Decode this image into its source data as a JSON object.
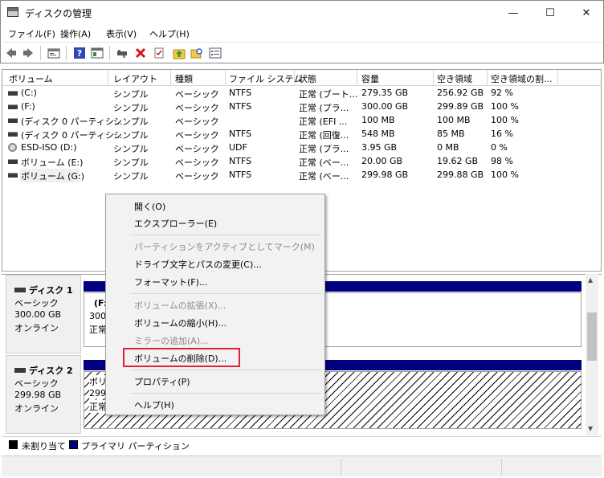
{
  "window": {
    "title": "ディスクの管理",
    "minimize_glyph": "—",
    "maximize_glyph": "☐",
    "close_glyph": "✕"
  },
  "menu": [
    "ファイル(F)",
    "操作(A)",
    "表示(V)",
    "ヘルプ(H)"
  ],
  "toolbar_icons": [
    "back-icon",
    "forward-icon",
    "properties-icon",
    "help-icon",
    "view-icon",
    "connect-icon",
    "delete-icon",
    "check-icon",
    "up-icon",
    "search-icon",
    "list-icon"
  ],
  "columns": [
    "ボリューム",
    "レイアウト",
    "種類",
    "ファイル システム",
    "状態",
    "容量",
    "空き領域",
    "空き領域の割..."
  ],
  "volumes": [
    {
      "name": "(C:)",
      "layout": "シンプル",
      "type": "ベーシック",
      "fs": "NTFS",
      "status": "正常 (ブート...",
      "capacity": "279.35 GB",
      "free": "256.92 GB",
      "pct": "92 %",
      "icon": "drive"
    },
    {
      "name": "(F:)",
      "layout": "シンプル",
      "type": "ベーシック",
      "fs": "NTFS",
      "status": "正常 (プラ...",
      "capacity": "300.00 GB",
      "free": "299.89 GB",
      "pct": "100 %",
      "icon": "drive"
    },
    {
      "name": "(ディスク 0 パーティシ...",
      "layout": "シンプル",
      "type": "ベーシック",
      "fs": "",
      "status": "正常 (EFI ...",
      "capacity": "100 MB",
      "free": "100 MB",
      "pct": "100 %",
      "icon": "drive"
    },
    {
      "name": "(ディスク 0 パーティシ...",
      "layout": "シンプル",
      "type": "ベーシック",
      "fs": "NTFS",
      "status": "正常 (回復...",
      "capacity": "548 MB",
      "free": "85 MB",
      "pct": "16 %",
      "icon": "drive"
    },
    {
      "name": "ESD-ISO (D:)",
      "layout": "シンプル",
      "type": "ベーシック",
      "fs": "UDF",
      "status": "正常 (プラ...",
      "capacity": "3.95 GB",
      "free": "0 MB",
      "pct": "0 %",
      "icon": "cd"
    },
    {
      "name": "ボリューム (E:)",
      "layout": "シンプル",
      "type": "ベーシック",
      "fs": "NTFS",
      "status": "正常 (ベー...",
      "capacity": "20.00 GB",
      "free": "19.62 GB",
      "pct": "98 %",
      "icon": "drive"
    },
    {
      "name": "ボリューム (G:)",
      "layout": "シンプル",
      "type": "ベーシック",
      "fs": "NTFS",
      "status": "正常 (ベー...",
      "capacity": "299.98 GB",
      "free": "299.88 GB",
      "pct": "100 %",
      "icon": "drive"
    }
  ],
  "disks": [
    {
      "name": "ディスク 1",
      "kind": "ベーシック",
      "size": "300.00 GB",
      "state": "オンライン",
      "part_title": "(F:",
      "part_size": "300.",
      "part_status": "正常"
    },
    {
      "name": "ディスク 2",
      "kind": "ベーシック",
      "size": "299.98 GB",
      "state": "オンライン",
      "part_title": "ボリ",
      "part_size": "299.",
      "part_status": "正常"
    }
  ],
  "legend": {
    "unallocated": "未割り当て",
    "primary": "プライマリ パーティション"
  },
  "context_menu": [
    {
      "label": "開く(O)",
      "enabled": true
    },
    {
      "label": "エクスプローラー(E)",
      "enabled": true
    },
    {
      "label": "パーティションをアクティブとしてマーク(M)",
      "enabled": false
    },
    {
      "label": "ドライブ文字とパスの変更(C)...",
      "enabled": true
    },
    {
      "label": "フォーマット(F)...",
      "enabled": true
    },
    {
      "label": "ボリュームの拡張(X)...",
      "enabled": false
    },
    {
      "label": "ボリュームの縮小(H)...",
      "enabled": true
    },
    {
      "label": "ミラーの追加(A)...",
      "enabled": false
    },
    {
      "label": "ボリュームの削除(D)...",
      "enabled": true,
      "highlighted": true
    },
    {
      "label": "プロパティ(P)",
      "enabled": true
    },
    {
      "label": "ヘルプ(H)",
      "enabled": true
    }
  ],
  "colors": {
    "primary_partition": "#000080",
    "highlight": "#e0203a"
  }
}
